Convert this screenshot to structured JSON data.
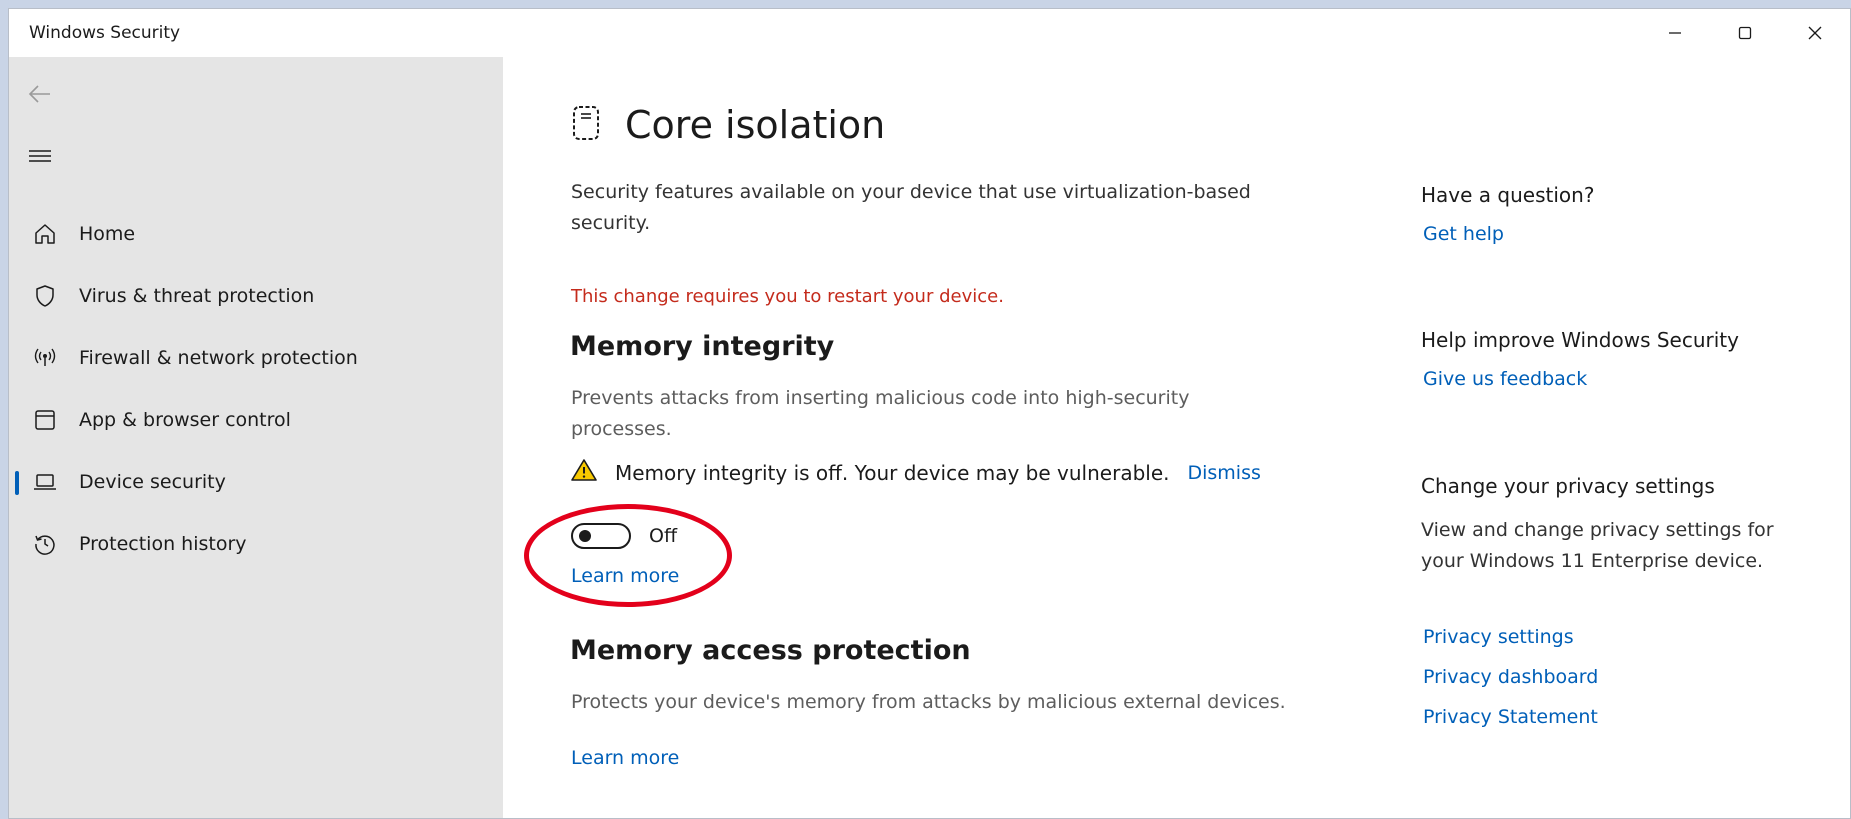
{
  "window": {
    "title": "Windows Security",
    "controls": [
      "minimize-icon",
      "maximize-icon",
      "close-icon"
    ]
  },
  "sidebar": {
    "back_icon": "back-arrow-icon",
    "menu_icon": "hamburger-menu-icon",
    "items": [
      {
        "label": "Home",
        "icon": "home-icon",
        "active": false
      },
      {
        "label": "Virus & threat protection",
        "icon": "shield-icon",
        "active": false
      },
      {
        "label": "Firewall & network protection",
        "icon": "wireless-antenna-icon",
        "active": false
      },
      {
        "label": "App & browser control",
        "icon": "app-window-icon",
        "active": false
      },
      {
        "label": "Device security",
        "icon": "laptop-icon",
        "active": true
      },
      {
        "label": "Protection history",
        "icon": "history-icon",
        "active": false
      }
    ]
  },
  "main": {
    "title": "Core isolation",
    "title_icon": "core-isolation-chip-icon",
    "description": "Security features available on your device that use virtualization-based security.",
    "restart_note": "This change requires you to restart your device.",
    "memory_integrity": {
      "heading": "Memory integrity",
      "description": "Prevents attacks from inserting malicious code into high-security processes.",
      "warning_icon": "warning-triangle-icon",
      "warning_text": "Memory integrity is off. Your device may be vulnerable.",
      "dismiss_label": "Dismiss",
      "toggle_state": "Off",
      "learn_more": "Learn more"
    },
    "memory_access": {
      "heading": "Memory access protection",
      "description": "Protects your device's memory from attacks by malicious external devices.",
      "learn_more": "Learn more"
    }
  },
  "side_panel": {
    "question_heading": "Have a question?",
    "get_help": "Get help",
    "improve_heading": "Help improve Windows Security",
    "feedback": "Give us feedback",
    "privacy_heading": "Change your privacy settings",
    "privacy_text": "View and change privacy settings for your Windows 11 Enterprise device.",
    "privacy_links": [
      "Privacy settings",
      "Privacy dashboard",
      "Privacy Statement"
    ]
  },
  "colors": {
    "accent": "#005fb8",
    "warning_red": "#c42b1c",
    "annotation_red": "#e3001b",
    "sidebar_bg": "#e5e5e5"
  }
}
